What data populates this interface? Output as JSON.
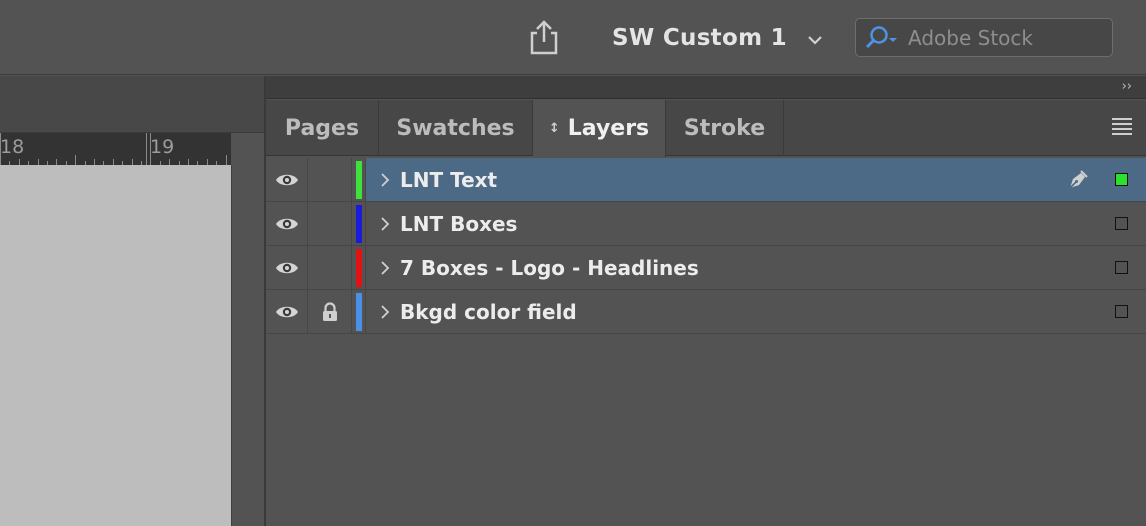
{
  "appbar": {
    "workspace_label": "SW Custom 1",
    "stock_placeholder": "Adobe Stock"
  },
  "ruler": {
    "labels": [
      "18",
      "19"
    ]
  },
  "panel": {
    "tabs": [
      {
        "label": "Pages",
        "active": false
      },
      {
        "label": "Swatches",
        "active": false
      },
      {
        "label": "Layers",
        "active": true
      },
      {
        "label": "Stroke",
        "active": false
      }
    ]
  },
  "layers": [
    {
      "name": "LNT Text",
      "color": "#3ee03e",
      "visible": true,
      "locked": false,
      "selected": true
    },
    {
      "name": "LNT Boxes",
      "color": "#1a1adc",
      "visible": true,
      "locked": false,
      "selected": false
    },
    {
      "name": "7 Boxes - Logo - Headlines",
      "color": "#e01212",
      "visible": true,
      "locked": false,
      "selected": false
    },
    {
      "name": "Bkgd color field",
      "color": "#4a90e8",
      "visible": true,
      "locked": true,
      "selected": false
    }
  ],
  "icons": {
    "share": "share-icon",
    "chevron": "chevron-down-icon",
    "search": "search-icon",
    "eye": "eye-icon",
    "lock": "lock-icon",
    "disclosure": "chevron-right-icon",
    "pen": "pen-nib-icon",
    "panel_menu": "hamburger-menu-icon",
    "collapse": "double-chevron-right-icon"
  },
  "colors": {
    "selection": "#4c6a86",
    "target_square": "#2ee02e"
  }
}
